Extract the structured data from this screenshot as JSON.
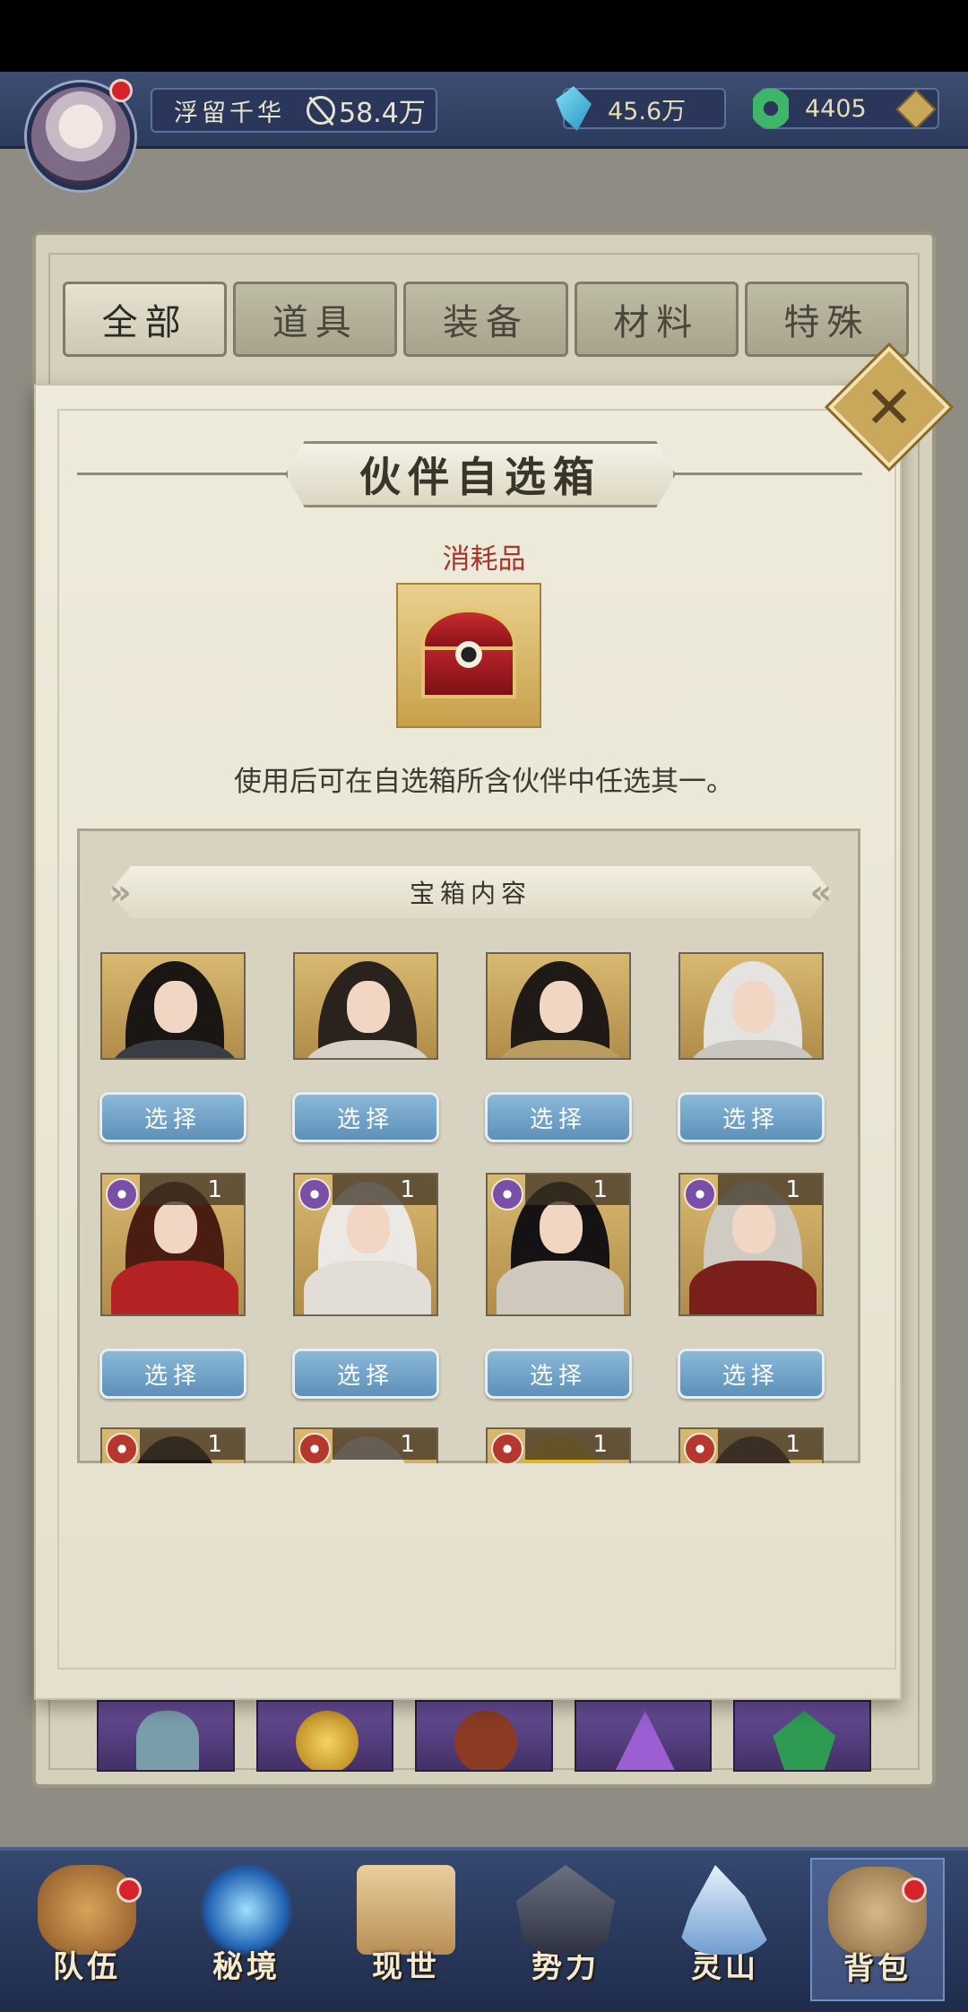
{
  "player": {
    "name": "浮留千华",
    "power": "58.4万"
  },
  "currencies": {
    "crystal": "45.6万",
    "jade": "4405"
  },
  "tabs": [
    "全部",
    "道具",
    "装备",
    "材料",
    "特殊"
  ],
  "popup": {
    "title": "伙伴自选箱",
    "item_type": "消耗品",
    "description": "使用后可在自选箱所含伙伴中任选其一。",
    "contents_header": "宝箱内容",
    "select_label": "选择",
    "partners_row1": [
      {
        "hair": "#1a1614",
        "robe": "#3b3d45"
      },
      {
        "hair": "#2a221c",
        "robe": "#d8d2c6"
      },
      {
        "hair": "#201a16",
        "robe": "#b89d5e"
      },
      {
        "hair": "#e5e3df",
        "robe": "#c9c6bf"
      }
    ],
    "partners_row2": [
      {
        "hair": "#4a1c12",
        "robe": "#b52223",
        "count": "1",
        "element": "purple"
      },
      {
        "hair": "#ece9e4",
        "robe": "#e2ddd6",
        "count": "1",
        "element": "purple"
      },
      {
        "hair": "#141213",
        "robe": "#cfc8bd",
        "count": "1",
        "element": "purple"
      },
      {
        "hair": "#cfcac2",
        "robe": "#7a1f1a",
        "count": "1",
        "element": "purple"
      }
    ],
    "partners_row3": [
      {
        "hair": "#1c1816",
        "robe": "#333",
        "count": "1",
        "element": "red"
      },
      {
        "hair": "#e4e1dc",
        "robe": "#ddd",
        "count": "1",
        "element": "red"
      },
      {
        "hair": "#e0b22a",
        "robe": "#a77d1c",
        "count": "1",
        "element": "red"
      },
      {
        "hair": "#3a2a22",
        "robe": "#2a2a2a",
        "count": "1",
        "element": "red"
      }
    ]
  },
  "nav": [
    {
      "label": "队伍",
      "icon": "team-icon",
      "color": "#b57a3a",
      "badge": true
    },
    {
      "label": "秘境",
      "icon": "portal-icon",
      "color": "#2d7fd0",
      "badge": false
    },
    {
      "label": "现世",
      "icon": "map-scroll-icon",
      "color": "#d9b478",
      "badge": false
    },
    {
      "label": "势力",
      "icon": "palace-icon",
      "color": "#4a4f5e",
      "badge": false
    },
    {
      "label": "灵山",
      "icon": "mountain-icon",
      "color": "#8cb3de",
      "badge": false
    },
    {
      "label": "背包",
      "icon": "backpack-icon",
      "color": "#b89466",
      "badge": true
    }
  ]
}
